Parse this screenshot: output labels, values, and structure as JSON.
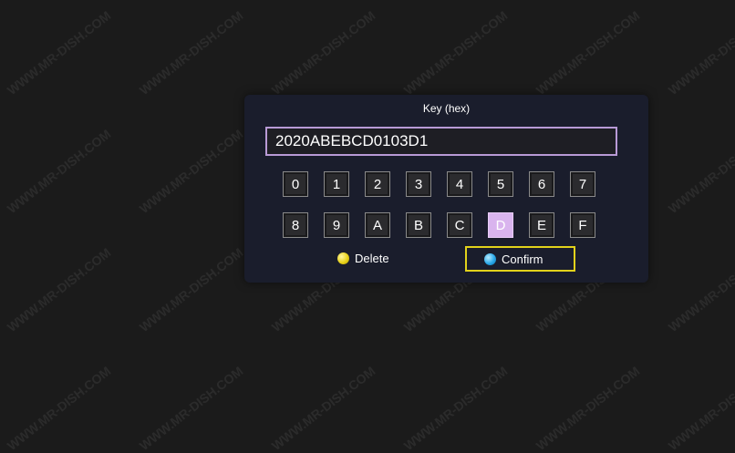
{
  "dialog": {
    "title": "Key (hex)",
    "key_value": "2020ABEBCD0103D1"
  },
  "keyboard": {
    "row1": [
      "0",
      "1",
      "2",
      "3",
      "4",
      "5",
      "6",
      "7"
    ],
    "row2": [
      "8",
      "9",
      "A",
      "B",
      "C",
      "D",
      "E",
      "F"
    ],
    "selected": "D"
  },
  "actions": {
    "delete_label": "Delete",
    "delete_color": "yellow",
    "confirm_label": "Confirm",
    "confirm_color": "blue"
  },
  "watermark": "WWW.MR-DISH.COM",
  "colors": {
    "background": "#1b1b1b",
    "dialog": "#1a1d2c",
    "field_border": "#b89ad6",
    "selected_key": "#d9b4ee",
    "focus_border": "#e2d21b"
  }
}
